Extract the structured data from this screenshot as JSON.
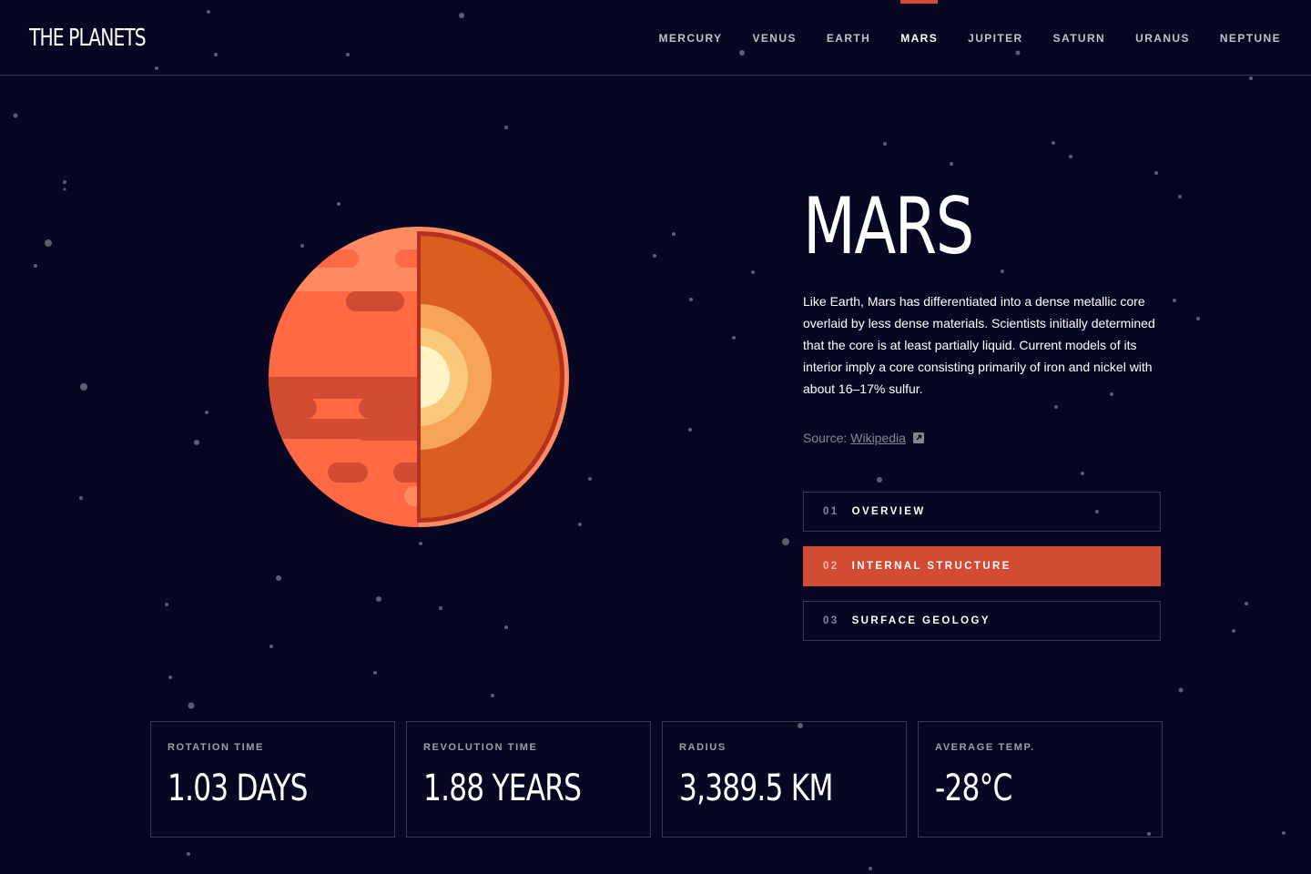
{
  "header": {
    "logo": "THE PLANETS",
    "nav": [
      {
        "label": "MERCURY",
        "active": false
      },
      {
        "label": "VENUS",
        "active": false
      },
      {
        "label": "EARTH",
        "active": false
      },
      {
        "label": "MARS",
        "active": true
      },
      {
        "label": "JUPITER",
        "active": false
      },
      {
        "label": "SATURN",
        "active": false
      },
      {
        "label": "URANUS",
        "active": false
      },
      {
        "label": "NEPTUNE",
        "active": false
      }
    ]
  },
  "planet": {
    "name": "MARS",
    "description": "Like Earth, Mars has differentiated into a dense metallic core overlaid by less dense materials. Scientists initially determined that the core is at least partially liquid. Current models of its interior imply a core consisting primarily of iron and nickel with about 16–17% sulfur.",
    "source_label": "Source:",
    "source_link": "Wikipedia"
  },
  "tabs": [
    {
      "num": "01",
      "label": "OVERVIEW",
      "active": false
    },
    {
      "num": "02",
      "label": "INTERNAL STRUCTURE",
      "active": true
    },
    {
      "num": "03",
      "label": "SURFACE GEOLOGY",
      "active": false
    }
  ],
  "stats": [
    {
      "label": "ROTATION TIME",
      "value": "1.03 DAYS"
    },
    {
      "label": "REVOLUTION TIME",
      "value": "1.88 YEARS"
    },
    {
      "label": "RADIUS",
      "value": "3,389.5 KM"
    },
    {
      "label": "AVERAGE TEMP.",
      "value": "-28°C"
    }
  ],
  "colors": {
    "background": "#070724",
    "accent": "#D14C32",
    "planet_surface": "#FF6A45",
    "planet_mantle": "#D95F1F"
  },
  "icons": {
    "external_link": "external-link-icon"
  }
}
